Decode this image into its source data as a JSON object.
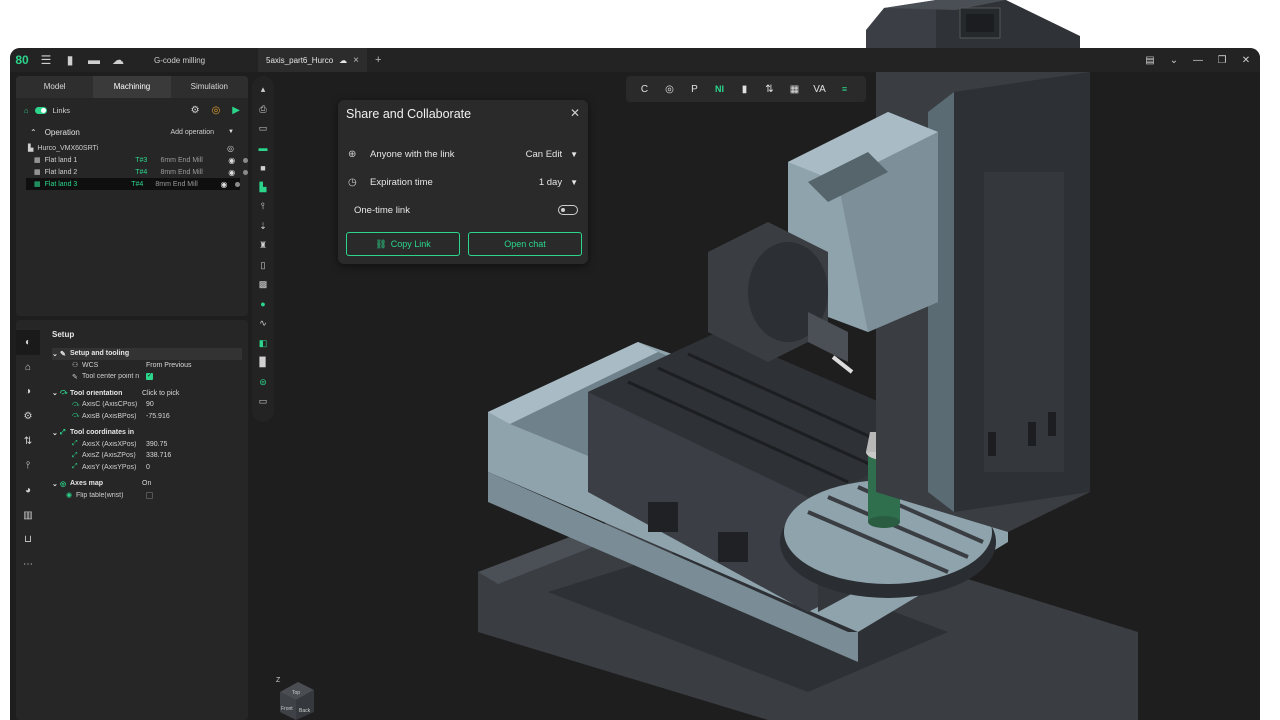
{
  "titlebar": {
    "logo": "80",
    "menu_icon": "menu-icon",
    "title": "G-code milling",
    "tab_label": "5axis_part6_Hurco",
    "tab_close": "×",
    "tab_add": "+"
  },
  "mode_tabs": [
    "Model",
    "Machining",
    "Simulation"
  ],
  "links": {
    "label": "Links"
  },
  "operation": {
    "header": "Operation",
    "add_label": "Add operation",
    "machine": "Hurco_VMX60SRTi",
    "rows": [
      {
        "name": "Flat land 1",
        "tool_no": "T#3",
        "tool": "6mm End Mill"
      },
      {
        "name": "Flat land 2",
        "tool_no": "T#4",
        "tool": "8mm End Mill"
      },
      {
        "name": "Flat land 3",
        "tool_no": "T#4",
        "tool": "8mm End Mill"
      }
    ]
  },
  "setup": {
    "title": "Setup",
    "groups": {
      "setup_tooling": "Setup and tooling",
      "wcs_k": "WCS",
      "wcs_v": "From Previous",
      "tcp_k": "Tool center point n",
      "tool_orientation": "Tool orientation",
      "tool_orientation_v": "Click to pick",
      "axis_c_k": "AxisC (AxisCPos)",
      "axis_c_v": "90",
      "axis_b_k": "AxisB (AxisBPos)",
      "axis_b_v": "-75.916",
      "tool_coords": "Tool coordinates in",
      "axis_x_k": "AxisX (AxisXPos)",
      "axis_x_v": "390.75",
      "axis_z_k": "AxisZ (AxisZPos)",
      "axis_z_v": "338.716",
      "axis_y_k": "AxisY (AxisYPos)",
      "axis_y_v": "0",
      "axes_map": "Axes map",
      "axes_map_v": "On",
      "flip_k": "Flip table(wrist)"
    }
  },
  "toolbar": {
    "items": [
      "C",
      "◎",
      "P",
      "NI",
      "▮",
      "⇅",
      "▦",
      "VA",
      "≡"
    ]
  },
  "dialog": {
    "title": "Share and Collaborate",
    "access_label": "Anyone with the link",
    "access_value": "Can Edit",
    "expiration_label": "Expiration time",
    "expiration_value": "1 day",
    "onetime_label": "One-time link",
    "copy_button": "Copy Link",
    "chat_button": "Open chat"
  },
  "view_cube": {
    "axis": "Z",
    "top": "Top",
    "front": "Front",
    "back": "Back"
  },
  "colors": {
    "accent": "#2bd68c",
    "background": "#1e1e1e",
    "panel": "#262626",
    "machine_dark": "#3a3d42",
    "machine_light": "#8fa3ad"
  }
}
